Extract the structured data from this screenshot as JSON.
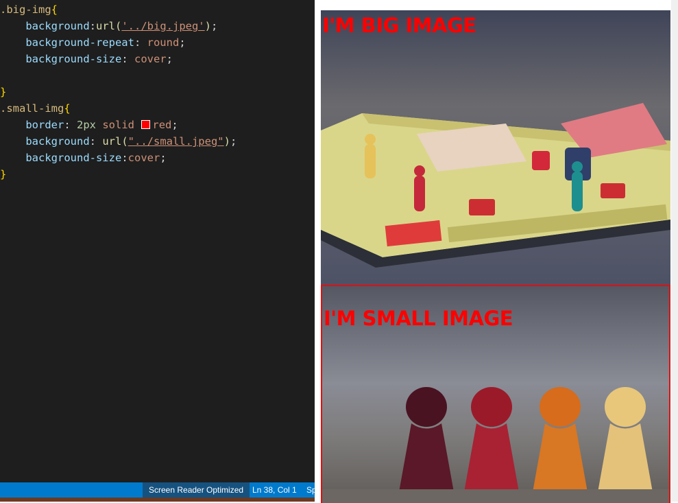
{
  "editor": {
    "lines": [
      [
        {
          "cls": "sel",
          "t": ".big-img"
        },
        {
          "cls": "brace",
          "t": "{"
        }
      ],
      [
        {
          "cls": "",
          "t": "    "
        },
        {
          "cls": "prop",
          "t": "background"
        },
        {
          "cls": "",
          "t": ":"
        },
        {
          "cls": "fn",
          "t": "url("
        },
        {
          "cls": "str",
          "t": "'../big.jpeg'"
        },
        {
          "cls": "fn",
          "t": ")"
        },
        {
          "cls": "",
          "t": ";"
        }
      ],
      [
        {
          "cls": "",
          "t": "    "
        },
        {
          "cls": "prop",
          "t": "background-repeat"
        },
        {
          "cls": "",
          "t": ": "
        },
        {
          "cls": "val",
          "t": "round"
        },
        {
          "cls": "",
          "t": ";"
        }
      ],
      [
        {
          "cls": "",
          "t": "    "
        },
        {
          "cls": "prop",
          "t": "background-size"
        },
        {
          "cls": "",
          "t": ": "
        },
        {
          "cls": "val",
          "t": "cover"
        },
        {
          "cls": "",
          "t": ";"
        }
      ],
      [],
      [
        {
          "cls": "brace",
          "t": "}"
        }
      ],
      [
        {
          "cls": "sel",
          "t": ".small-img"
        },
        {
          "cls": "brace",
          "t": "{"
        }
      ],
      [
        {
          "cls": "",
          "t": "    "
        },
        {
          "cls": "prop",
          "t": "border"
        },
        {
          "cls": "",
          "t": ": "
        },
        {
          "cls": "num",
          "t": "2px"
        },
        {
          "cls": "",
          "t": " "
        },
        {
          "cls": "val",
          "t": "solid"
        },
        {
          "cls": "",
          "t": " "
        },
        {
          "cls": "swatch",
          "t": ""
        },
        {
          "cls": "val",
          "t": "red"
        },
        {
          "cls": "",
          "t": ";"
        }
      ],
      [
        {
          "cls": "",
          "t": "    "
        },
        {
          "cls": "prop",
          "t": "background"
        },
        {
          "cls": "",
          "t": ": "
        },
        {
          "cls": "fn",
          "t": "url("
        },
        {
          "cls": "str",
          "t": "\"../small.jpeg\""
        },
        {
          "cls": "fn",
          "t": ")"
        },
        {
          "cls": "",
          "t": ";"
        }
      ],
      [
        {
          "cls": "",
          "t": "    "
        },
        {
          "cls": "prop",
          "t": "background-size"
        },
        {
          "cls": "",
          "t": ":"
        },
        {
          "cls": "val",
          "t": "cover"
        },
        {
          "cls": "",
          "t": ";"
        }
      ],
      [
        {
          "cls": "brace",
          "t": "}"
        }
      ]
    ]
  },
  "statusbar": {
    "screen_reader": "Screen Reader Optimized",
    "position": "Ln 38, Col 1",
    "spaces": "Sp"
  },
  "preview": {
    "big_caption": "I'M BIG IMAGE",
    "small_caption": "I'M SMALL IMAGE"
  },
  "colors": {
    "editor_bg": "#1e1e1e",
    "statusbar_bg": "#007acc",
    "caption_red": "#ff0000"
  }
}
